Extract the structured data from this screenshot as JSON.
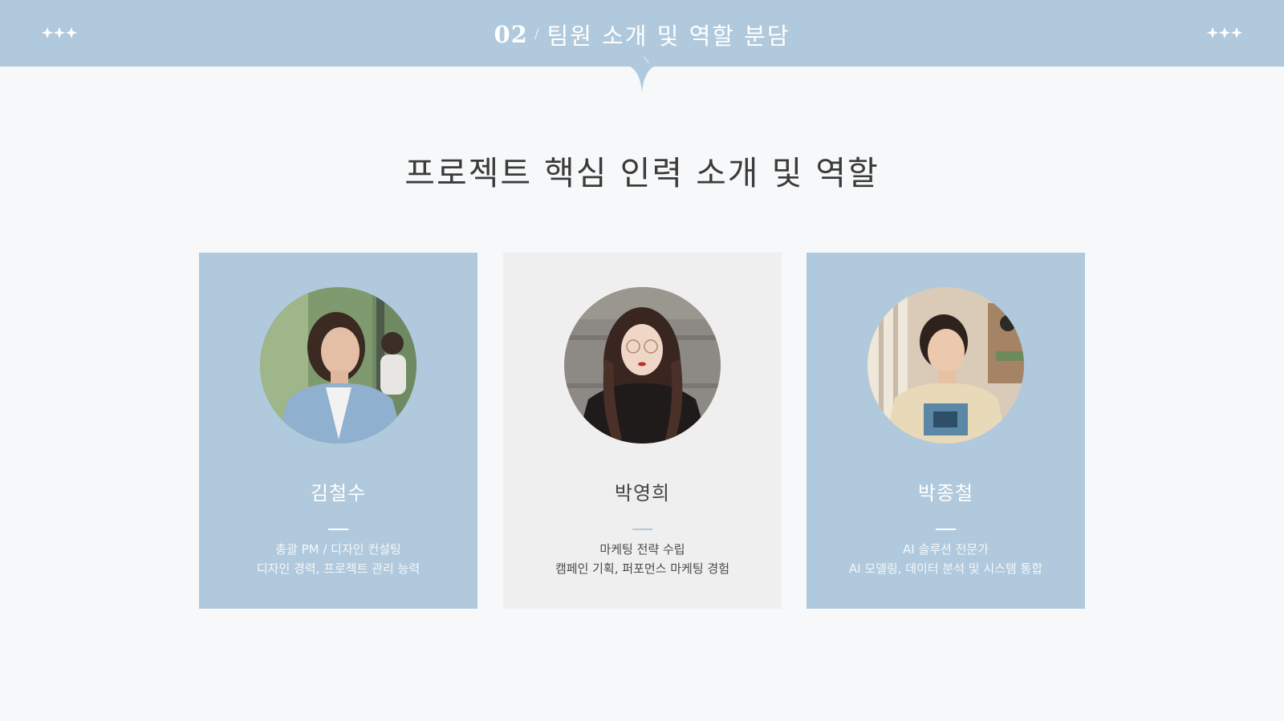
{
  "header": {
    "section_number": "02",
    "section_separator": "/",
    "section_title": "팀원 소개 및 역할 분담",
    "decor_left": "sparkles-icon",
    "decor_right": "sparkles-icon"
  },
  "main": {
    "heading": "프로젝트 핵심 인력 소개 및 역할"
  },
  "members": [
    {
      "name": "김철수",
      "role_line1": "총괄 PM / 디자인 컨설팅",
      "role_line2": "디자인 경력, 프로젝트 관리 능력",
      "card_color": "#b0c9dc"
    },
    {
      "name": "박영희",
      "role_line1": "마케팅 전략 수립",
      "role_line2": "캠페인 기획, 퍼포먼스 마케팅 경험",
      "card_color": "#efefef"
    },
    {
      "name": "박종철",
      "role_line1": "AI 솔루션 전문가",
      "role_line2": "AI 모델링, 데이터 분석 및 시스템 통합",
      "card_color": "#b0c9dc"
    }
  ],
  "colors": {
    "accent": "#b0c9dc",
    "background": "#f7f8f9",
    "heading_text": "#3b3b3b"
  }
}
